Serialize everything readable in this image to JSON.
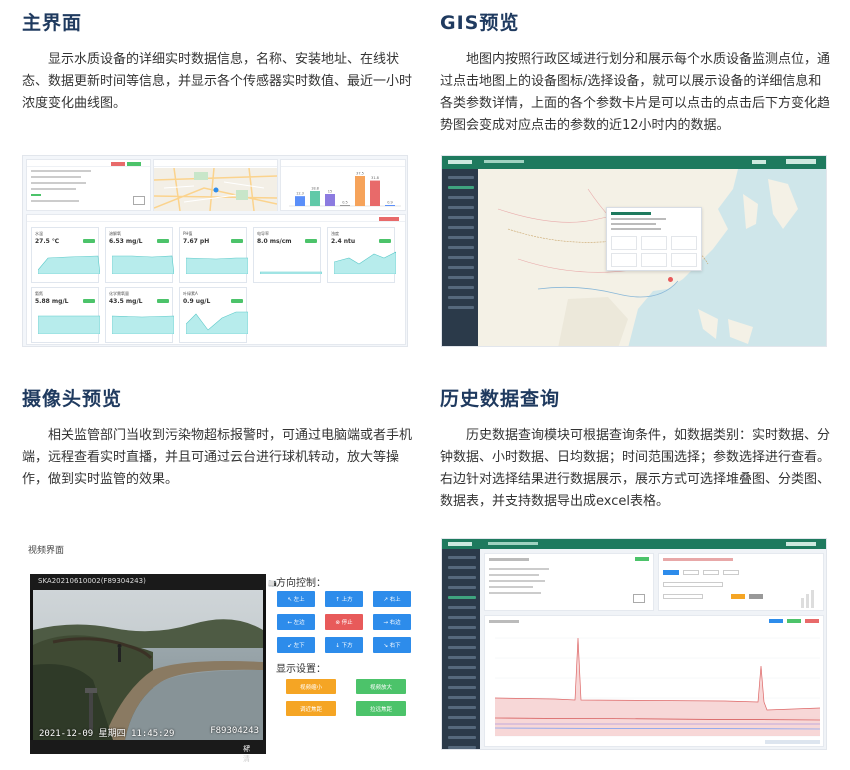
{
  "sections": {
    "main": {
      "title": "主界面",
      "desc": "显示水质设备的详细实时数据信息，名称、安装地址、在线状态、数据更新时间等信息，并显示各个传感器实时数值、最近一小时浓度变化曲线图。"
    },
    "gis": {
      "title": "GIS预览",
      "desc": "地图内按照行政区域进行划分和展示每个水质设备监测点位，通过点击地图上的设备图标/选择设备，就可以展示设备的详细信息和各类参数详情，上面的各个参数卡片是可以点击的点击后下方变化趋势图会变成对应点击的参数的近12小时内的数据。"
    },
    "camera": {
      "title": "摄像头预览",
      "desc": "相关监管部门当收到污染物超标报警时，可通过电脑端或者手机端，远程查看实时直播，并且可通过云台进行球机转动，放大等操作，做到实时监管的效果。"
    },
    "history": {
      "title": "历史数据查询",
      "desc": "历史数据查询模块可根据查询条件，如数据类别：实时数据、分钟数据、小时数据、日均数据；时间范围选择；参数选择进行查看。右边针对选择结果进行数据展示，展示方式可选择堆叠图、分类图、数据表，并支持数据导出成excel表格。"
    }
  },
  "dashboard": {
    "tiles": [
      {
        "name": "水温",
        "value": "27.5 ℃"
      },
      {
        "name": "溶解氧",
        "value": "6.53 mg/L"
      },
      {
        "name": "PH值",
        "value": "7.67 pH"
      },
      {
        "name": "电导率",
        "value": "8.0 ms/cm"
      },
      {
        "name": "浊度",
        "value": "2.4 ntu"
      },
      {
        "name": "氨氮",
        "value": "5.88 mg/L"
      },
      {
        "name": "化学需氧量",
        "value": "43.5 mg/L"
      },
      {
        "name": "叶绿素A",
        "value": "0.9 ug/L"
      }
    ],
    "bars": [
      {
        "value": 12.3,
        "color": "#5b8ff9"
      },
      {
        "value": 18.8,
        "color": "#61c9a8"
      },
      {
        "value": 15.0,
        "color": "#8c7be0"
      },
      {
        "value": 0.5,
        "color": "#999999"
      },
      {
        "value": 37.5,
        "color": "#f6a35a"
      },
      {
        "value": 31.8,
        "color": "#e86a6a"
      },
      {
        "value": 0.9,
        "color": "#5b8ff9"
      }
    ]
  },
  "camera": {
    "view_label": "视频界面",
    "device_id": "SKA20210610002(F89304243)",
    "timestamp": "2021-12-09  星期四  11:45:29",
    "serial": "F89304243",
    "quality": "标清",
    "direction_title": "方向控制：",
    "display_title": "显示设置：",
    "direction_buttons": [
      "↖ 左上",
      "↑ 上方",
      "↗ 右上",
      "← 左边",
      "⊗ 停止",
      "→ 右边",
      "↙ 左下",
      "↓ 下方",
      "↘ 右下"
    ],
    "display_buttons": [
      "视频缩小",
      "视频放大",
      "调近焦距",
      "拉远焦距"
    ]
  },
  "colors": {
    "title": "#1f3a5f",
    "platform_green": "#1e7a5e",
    "sidebar": "#2b3a4a",
    "button_blue": "#2d8ceb",
    "stop_red": "#e85a5a",
    "orange": "#f5a524",
    "green": "#4cc36a"
  }
}
